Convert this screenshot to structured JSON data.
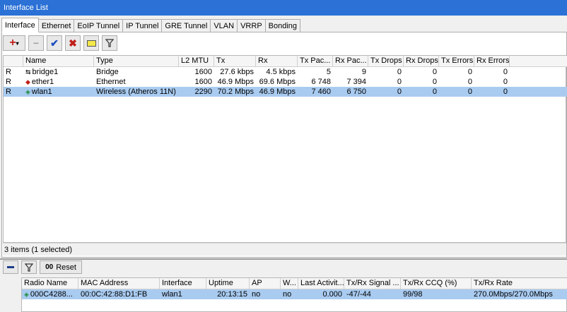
{
  "window": {
    "title": "Interface List"
  },
  "tabs": [
    "Interface",
    "Ethernet",
    "EoIP Tunnel",
    "IP Tunnel",
    "GRE Tunnel",
    "VLAN",
    "VRRP",
    "Bonding"
  ],
  "toolbar": {
    "add": "+",
    "remove": "−",
    "enable": "✔",
    "disable": "✖",
    "comment": "▭",
    "filter": "⏷"
  },
  "table": {
    "columns": [
      "Name",
      "Type",
      "L2 MTU",
      "Tx",
      "Rx",
      "Tx Pac...",
      "Rx Pac...",
      "Tx Drops",
      "Rx Drops",
      "Tx Errors",
      "Rx Errors"
    ],
    "rows": [
      {
        "flag": "R",
        "name": "bridge1",
        "type": "Bridge",
        "l2mtu": "1600",
        "tx": "27.6 kbps",
        "rx": "4.5 kbps",
        "txp": "5",
        "rxp": "9",
        "txd": "0",
        "rxd": "0",
        "txe": "0",
        "rxe": "0"
      },
      {
        "flag": "R",
        "name": "ether1",
        "type": "Ethernet",
        "l2mtu": "1600",
        "tx": "46.9 Mbps",
        "rx": "69.6 Mbps",
        "txp": "6 748",
        "rxp": "7 394",
        "txd": "0",
        "rxd": "0",
        "txe": "0",
        "rxe": "0"
      },
      {
        "flag": "R",
        "name": "wlan1",
        "type": "Wireless (Atheros 11N)",
        "l2mtu": "2290",
        "tx": "70.2 Mbps",
        "rx": "46.9 Mbps",
        "txp": "7 460",
        "rxp": "6 750",
        "txd": "0",
        "rxd": "0",
        "txe": "0",
        "rxe": "0"
      }
    ]
  },
  "status": "3 items (1 selected)",
  "bottom": {
    "reset": "Reset",
    "reset_prefix": "00",
    "columns": [
      "Radio Name",
      "MAC Address",
      "Interface",
      "Uptime",
      "AP",
      "W...",
      "Last Activit...",
      "Tx/Rx Signal ...",
      "Tx/Rx CCQ (%)",
      "Tx/Rx Rate"
    ],
    "row": {
      "radio": "000C4288...",
      "mac": "00:0C:42:88:D1:FB",
      "iface": "wlan1",
      "uptime": "20:13:15",
      "ap": "no",
      "w": "no",
      "last": "0.000",
      "signal": "-47/-44",
      "ccq": "99/98",
      "rate": "270.0Mbps/270.0Mbps"
    }
  },
  "colors": {
    "title": "#2b71d6",
    "selection": "#a9cbf0"
  }
}
